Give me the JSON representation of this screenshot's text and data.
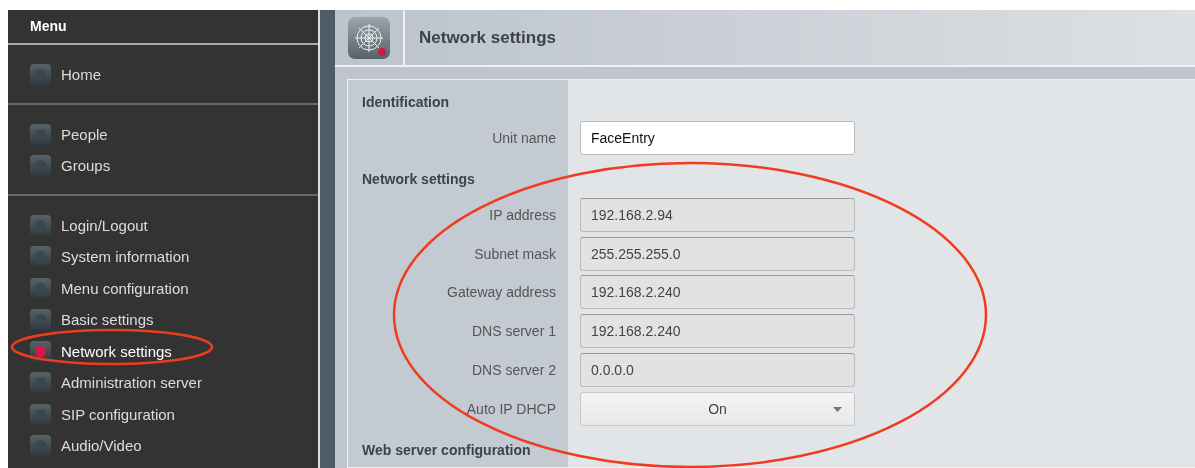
{
  "sidebar": {
    "title": "Menu",
    "sections": [
      [
        {
          "label": "Home",
          "selected": false
        }
      ],
      [
        {
          "label": "People",
          "selected": false
        },
        {
          "label": "Groups",
          "selected": false
        }
      ],
      [
        {
          "label": "Login/Logout",
          "selected": false
        },
        {
          "label": "System information",
          "selected": false
        },
        {
          "label": "Menu configuration",
          "selected": false
        },
        {
          "label": "Basic settings",
          "selected": false
        },
        {
          "label": "Network settings",
          "selected": true
        },
        {
          "label": "Administration server",
          "selected": false
        },
        {
          "label": "SIP configuration",
          "selected": false
        },
        {
          "label": "Audio/Video",
          "selected": false
        }
      ]
    ]
  },
  "page": {
    "title": "Network settings",
    "sections": [
      {
        "heading": "Identification",
        "rows": [
          {
            "label": "Unit name",
            "kind": "text",
            "value": "FaceEntry",
            "disabled": false
          }
        ]
      },
      {
        "heading": "Network settings",
        "rows": [
          {
            "label": "IP address",
            "kind": "text",
            "value": "192.168.2.94",
            "disabled": true
          },
          {
            "label": "Subnet mask",
            "kind": "text",
            "value": "255.255.255.0",
            "disabled": true
          },
          {
            "label": "Gateway address",
            "kind": "text",
            "value": "192.168.2.240",
            "disabled": true
          },
          {
            "label": "DNS server 1",
            "kind": "text",
            "value": "192.168.2.240",
            "disabled": true
          },
          {
            "label": "DNS server 2",
            "kind": "text",
            "value": "0.0.0.0",
            "disabled": true
          },
          {
            "label": "Auto IP DHCP",
            "kind": "select",
            "value": "On",
            "disabled": false
          }
        ]
      },
      {
        "heading": "Web server configuration"
      }
    ]
  }
}
